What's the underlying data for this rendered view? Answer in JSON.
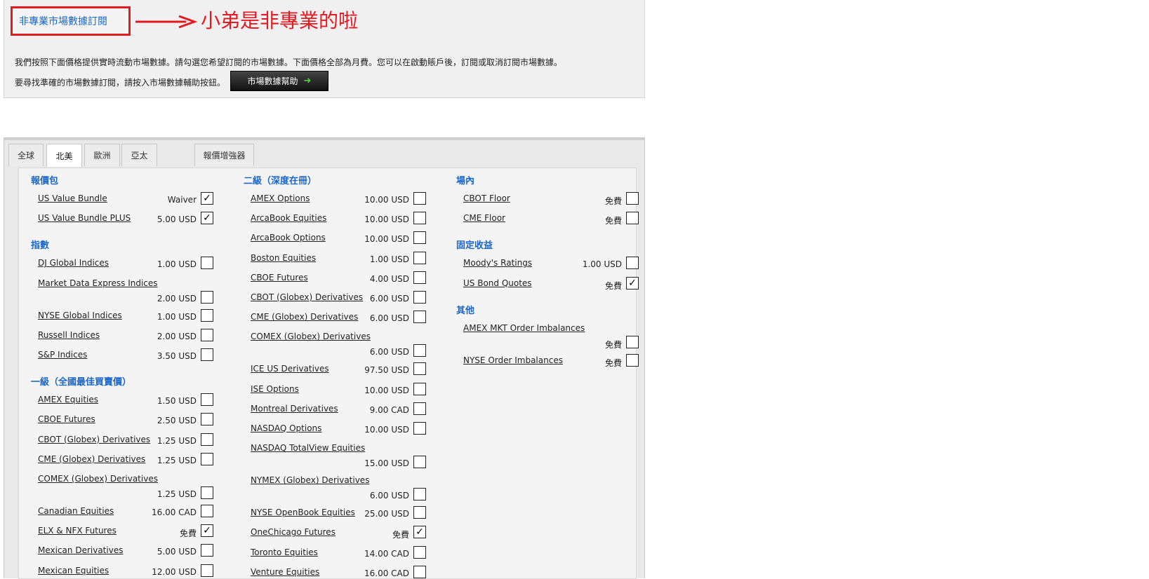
{
  "header": {
    "title": "非專業市場數據訂閱",
    "annotation": "小弟是非專業的啦",
    "intro_line1": "我們按照下面價格提供實時流動市場數據。請勾選您希望訂閱的市場數據。下面價格全部為月費。您可以在啟動賬戶後，訂閱或取消訂閱市場數據。",
    "intro_line2": "要尋找準確的市場數據訂閱，請按入市場數據輔助按鈕。",
    "help_button": "市場數據幫助",
    "help_icon": "arrow-right-icon",
    "accent": "#1a66c8",
    "annotation_color": "#e21a22"
  },
  "tabs": [
    {
      "label": "全球",
      "active": false
    },
    {
      "label": "北美",
      "active": true
    },
    {
      "label": "歐洲",
      "active": false
    },
    {
      "label": "亞太",
      "active": false
    },
    {
      "label": "報價增強器",
      "active": false
    }
  ],
  "columns": [
    {
      "sections": [
        {
          "title": "報價包",
          "items": [
            {
              "name": "US Value Bundle",
              "price": "Waiver",
              "checked": true
            },
            {
              "name": "US Value Bundle PLUS",
              "price": "5.00 USD",
              "checked": true
            }
          ]
        },
        {
          "title": "指數",
          "items": [
            {
              "name": "DJ Global Indices",
              "price": "1.00 USD",
              "checked": false
            },
            {
              "name": "Market Data Express Indices",
              "price": "2.00 USD",
              "checked": false,
              "wrap": true
            },
            {
              "name": "NYSE Global Indices",
              "price": "1.00 USD",
              "checked": false
            },
            {
              "name": "Russell Indices",
              "price": "2.00 USD",
              "checked": false
            },
            {
              "name": "S&P Indices",
              "price": "3.50 USD",
              "checked": false
            }
          ]
        },
        {
          "title": "一級（全國最佳買賣價）",
          "items": [
            {
              "name": "AMEX Equities",
              "price": "1.50 USD",
              "checked": false
            },
            {
              "name": "CBOE Futures",
              "price": "2.50 USD",
              "checked": false
            },
            {
              "name": "CBOT (Globex) Derivatives",
              "price": "1.25 USD",
              "checked": false
            },
            {
              "name": "CME (Globex) Derivatives",
              "price": "1.25 USD",
              "checked": false
            },
            {
              "name": "COMEX (Globex) Derivatives",
              "price": "1.25 USD",
              "checked": false,
              "wrap": true
            },
            {
              "name": "Canadian Equities",
              "price": "16.00 CAD",
              "checked": false
            },
            {
              "name": "ELX & NFX Futures",
              "price": "免費",
              "checked": true
            },
            {
              "name": "Mexican Derivatives",
              "price": "5.00 USD",
              "checked": false
            },
            {
              "name": "Mexican Equities",
              "price": "12.00 USD",
              "checked": false
            }
          ]
        }
      ]
    },
    {
      "sections": [
        {
          "title": "二級（深度在冊）",
          "items": [
            {
              "name": "AMEX Options",
              "price": "10.00 USD",
              "checked": false
            },
            {
              "name": "ArcaBook Equities",
              "price": "10.00 USD",
              "checked": false
            },
            {
              "name": "ArcaBook Options",
              "price": "10.00 USD",
              "checked": false
            },
            {
              "name": "Boston Equities",
              "price": "1.00 USD",
              "checked": false
            },
            {
              "name": "CBOE Futures",
              "price": "4.00 USD",
              "checked": false
            },
            {
              "name": "CBOT (Globex) Derivatives",
              "price": "6.00 USD",
              "checked": false
            },
            {
              "name": "CME (Globex) Derivatives",
              "price": "6.00 USD",
              "checked": false
            },
            {
              "name": "COMEX (Globex) Derivatives",
              "price": "6.00 USD",
              "checked": false,
              "wrap": true
            },
            {
              "name": "ICE US Derivatives",
              "price": "97.50 USD",
              "checked": false
            },
            {
              "name": "ISE Options",
              "price": "10.00 USD",
              "checked": false
            },
            {
              "name": "Montreal Derivatives",
              "price": "9.00 CAD",
              "checked": false
            },
            {
              "name": "NASDAQ Options",
              "price": "10.00 USD",
              "checked": false
            },
            {
              "name": "NASDAQ TotalView Equities",
              "price": "15.00 USD",
              "checked": false,
              "wrap": true
            },
            {
              "name": "NYMEX (Globex) Derivatives",
              "price": "6.00 USD",
              "checked": false,
              "wrap": true
            },
            {
              "name": "NYSE OpenBook Equities",
              "price": "25.00 USD",
              "checked": false
            },
            {
              "name": "OneChicago Futures",
              "price": "免費",
              "checked": true
            },
            {
              "name": "Toronto Equities",
              "price": "14.00 CAD",
              "checked": false
            },
            {
              "name": "Venture Equities",
              "price": "16.00 CAD",
              "checked": false
            }
          ]
        }
      ]
    },
    {
      "sections": [
        {
          "title": "場內",
          "items": [
            {
              "name": "CBOT Floor",
              "price": "免費",
              "checked": false
            },
            {
              "name": "CME Floor",
              "price": "免費",
              "checked": false
            }
          ]
        },
        {
          "title": "固定收益",
          "items": [
            {
              "name": "Moody's Ratings",
              "price": "1.00 USD",
              "checked": false
            },
            {
              "name": "US Bond Quotes",
              "price": "免費",
              "checked": true
            }
          ]
        },
        {
          "title": "其他",
          "items": [
            {
              "name": "AMEX MKT Order Imbalances",
              "price": "免費",
              "checked": false,
              "wrap": true
            },
            {
              "name": "NYSE Order Imbalances",
              "price": "免費",
              "checked": false
            }
          ]
        }
      ]
    }
  ]
}
